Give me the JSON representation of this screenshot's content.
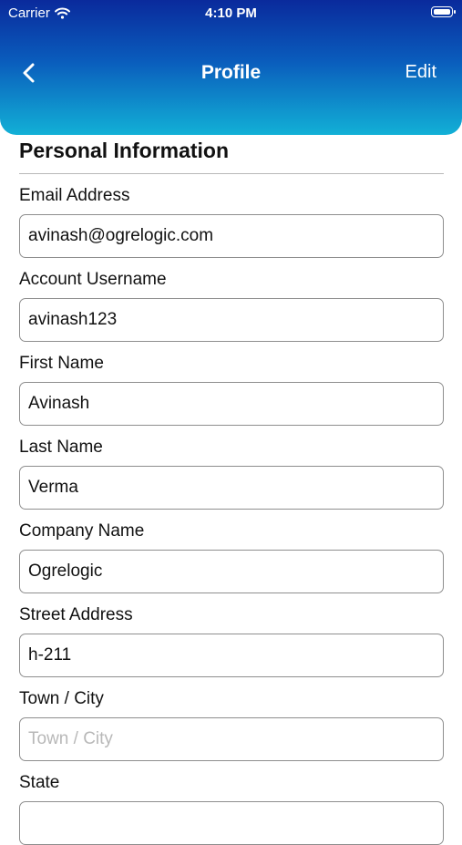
{
  "status_bar": {
    "carrier": "Carrier",
    "time": "4:10 PM"
  },
  "nav": {
    "title": "Profile",
    "edit_label": "Edit"
  },
  "section": {
    "title": "Personal Information"
  },
  "fields": [
    {
      "label": "Email Address",
      "value": "avinash@ogrelogic.com",
      "placeholder": ""
    },
    {
      "label": "Account Username",
      "value": "avinash123",
      "placeholder": ""
    },
    {
      "label": "First Name",
      "value": "Avinash",
      "placeholder": ""
    },
    {
      "label": "Last Name",
      "value": "Verma",
      "placeholder": ""
    },
    {
      "label": "Company Name",
      "value": "Ogrelogic",
      "placeholder": ""
    },
    {
      "label": "Street Address",
      "value": "h-211",
      "placeholder": ""
    },
    {
      "label": "Town / City",
      "value": "",
      "placeholder": "Town / City"
    },
    {
      "label": "State",
      "value": "",
      "placeholder": ""
    }
  ],
  "colors": {
    "header_top": "#0a2a9c",
    "header_bottom": "#12b0d6",
    "field_border": "#8e8e8e",
    "placeholder": "#b8b8b8"
  }
}
